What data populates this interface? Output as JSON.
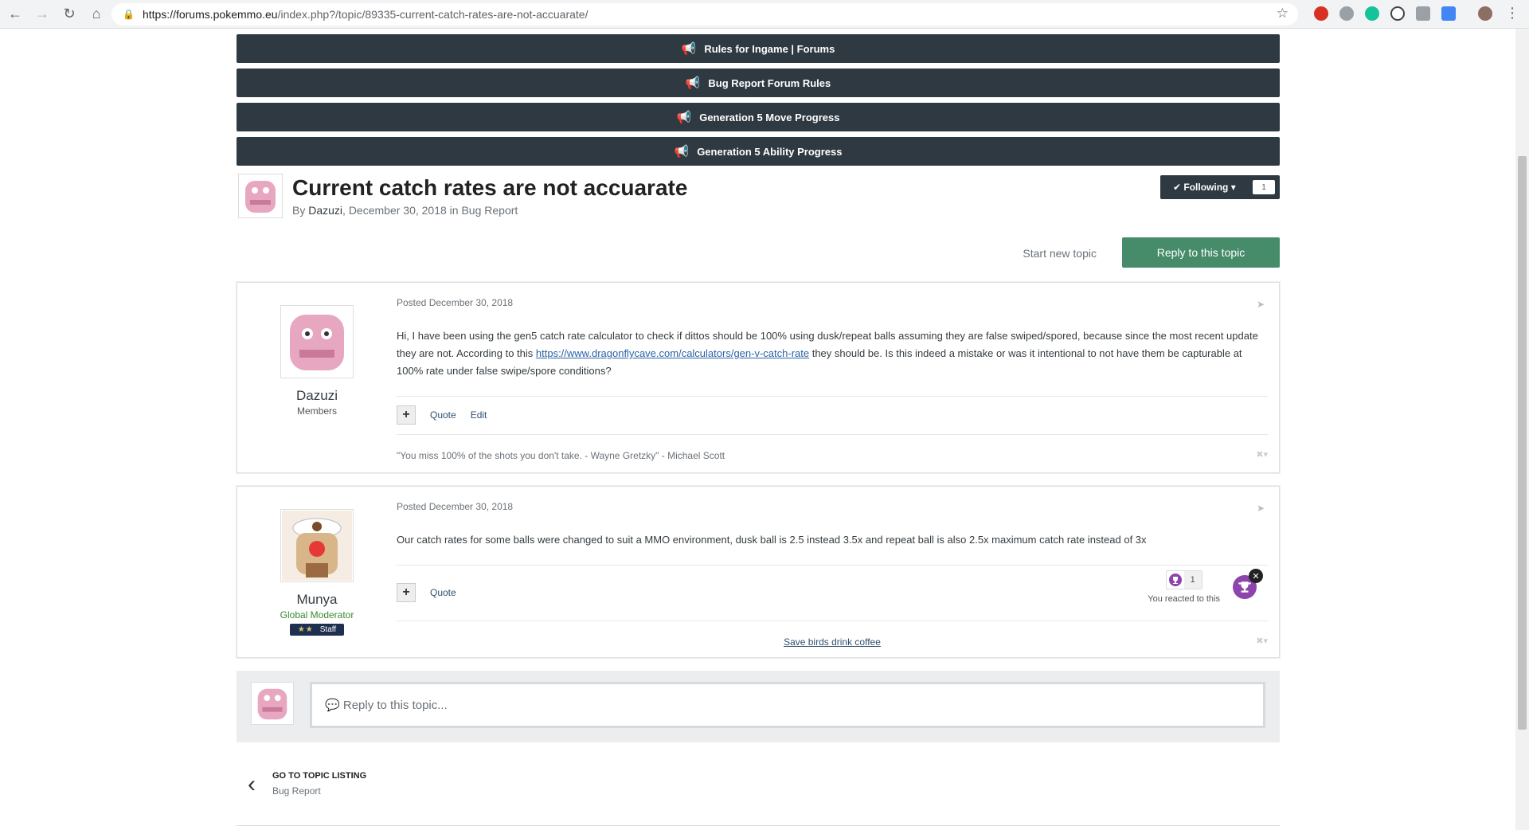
{
  "browser": {
    "url_host": "https://forums.pokemmo.eu",
    "url_path": "/index.php?/topic/89335-current-catch-rates-are-not-accuarate/"
  },
  "announcements": [
    {
      "label": "Rules for Ingame | Forums"
    },
    {
      "label": "Bug Report Forum Rules"
    },
    {
      "label": "Generation 5 Move Progress"
    },
    {
      "label": "Generation 5 Ability Progress"
    }
  ],
  "topic": {
    "title": "Current catch rates are not accuarate",
    "by_prefix": "By ",
    "author": "Dazuzi",
    "comma": ", ",
    "date": "December 30, 2018",
    "in_text": " in ",
    "forum": "Bug Report",
    "following_label": "Following",
    "following_count": "1"
  },
  "actions": {
    "start_new": "Start new topic",
    "reply": "Reply to this topic"
  },
  "posts": [
    {
      "author": "Dazuzi",
      "group": "Members",
      "posted_prefix": "Posted ",
      "posted_date": "December 30, 2018",
      "content_before": "Hi, I have been using the gen5 catch rate calculator to check if dittos should be 100% using dusk/repeat balls assuming they are false swiped/spored, because since the most recent update they are not. According to this ",
      "content_link": "https://www.dragonflycave.com/calculators/gen-v-catch-rate",
      "content_after": " they should be. Is this indeed a mistake or was it intentional to not have them be capturable at 100% rate under false swipe/spore conditions?",
      "quote": "Quote",
      "edit": "Edit",
      "signature": "\"You miss 100% of the shots you don't take. - Wayne Gretzky\" - Michael Scott"
    },
    {
      "author": "Munya",
      "group": "Global Moderator",
      "badge": "Staff",
      "posted_prefix": "Posted ",
      "posted_date": "December 30, 2018",
      "content": "Our catch rates for some balls were changed to suit a MMO environment, dusk ball is 2.5 instead 3.5x and repeat ball is also 2.5x maximum catch rate instead of 3x",
      "quote": "Quote",
      "reaction_count": "1",
      "reacted_text": "You reacted to this",
      "signature_link": "Save birds drink coffee"
    }
  ],
  "reply_box": {
    "placeholder": "Reply to this topic..."
  },
  "listing": {
    "label": "GO TO TOPIC LISTING",
    "forum": "Bug Report"
  },
  "colors": {
    "announce_bg": "#2f3941",
    "reply_btn": "#468c6a",
    "moderator_green": "#3a8a2f",
    "reaction_purple": "#8e44ad"
  }
}
